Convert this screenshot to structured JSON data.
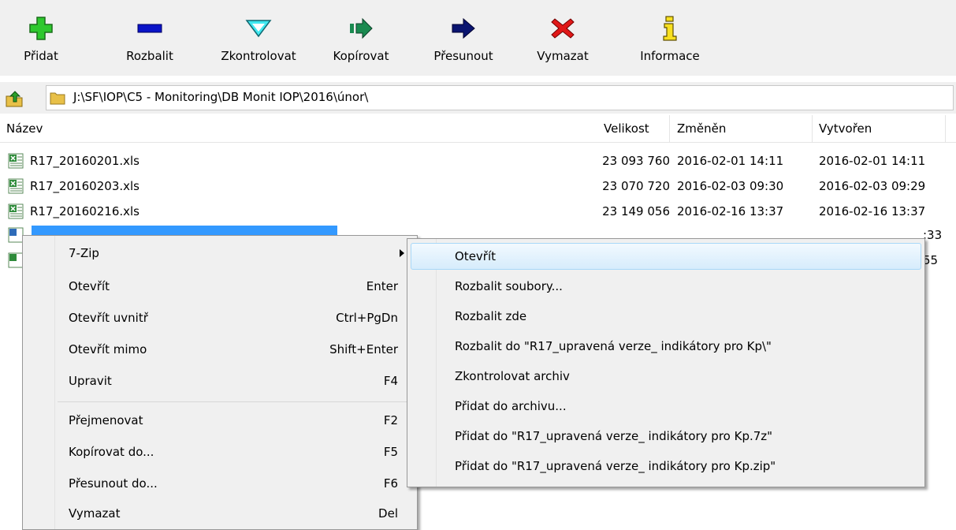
{
  "toolbar": {
    "buttons": [
      {
        "label": "Přidat",
        "icon": "plus-icon"
      },
      {
        "label": "Rozbalit",
        "icon": "minus-icon"
      },
      {
        "label": "Zkontrolovat",
        "icon": "check-icon"
      },
      {
        "label": "Kopírovat",
        "icon": "copy-arrow-icon"
      },
      {
        "label": "Přesunout",
        "icon": "move-arrow-icon"
      },
      {
        "label": "Vymazat",
        "icon": "delete-x-icon"
      },
      {
        "label": "Informace",
        "icon": "info-icon"
      }
    ]
  },
  "address": {
    "path": "J:\\SF\\IOP\\C5 - Monitoring\\DB Monit IOP\\2016\\únor\\"
  },
  "columns": {
    "name": "Název",
    "size": "Velikost",
    "modified": "Změněn",
    "created": "Vytvořen"
  },
  "files": [
    {
      "name": "R17_20160201.xls",
      "size": "23 093 760",
      "modified": "2016-02-01 14:11",
      "created": "2016-02-01 14:11"
    },
    {
      "name": "R17_20160203.xls",
      "size": "23 070 720",
      "modified": "2016-02-03 09:30",
      "created": "2016-02-03 09:29"
    },
    {
      "name": "R17_20160216.xls",
      "size": "23 149 056",
      "modified": "2016-02-16 13:37",
      "created": "2016-02-16 13:37"
    }
  ],
  "hidden_row_fragments": {
    "row4_created_tail": ":33",
    "row5_created_tail": "55"
  },
  "context_menu": {
    "items": [
      {
        "label": "7-Zip",
        "shortcut": "",
        "submenu": true
      },
      {
        "label": "Otevřít",
        "shortcut": "Enter"
      },
      {
        "label": "Otevřít uvnitř",
        "shortcut": "Ctrl+PgDn"
      },
      {
        "label": "Otevřít mimo",
        "shortcut": "Shift+Enter"
      },
      {
        "label": "Upravit",
        "shortcut": "F4"
      },
      {
        "label": "Přejmenovat",
        "shortcut": "F2"
      },
      {
        "label": "Kopírovat do...",
        "shortcut": "F5"
      },
      {
        "label": "Přesunout do...",
        "shortcut": "F6"
      },
      {
        "label": "Vymazat",
        "shortcut": "Del"
      }
    ]
  },
  "submenu": {
    "items": [
      "Otevřít",
      "Rozbalit soubory...",
      "Rozbalit zde",
      "Rozbalit do \"R17_upravená verze_ indikátory pro Kp\\\"",
      "Zkontrolovat archiv",
      "Přidat do archivu...",
      "Přidat do \"R17_upravená verze_ indikátory pro Kp.7z\"",
      "Přidat do \"R17_upravená verze_ indikátory pro Kp.zip\""
    ]
  },
  "colors": {
    "selection": "#3399ff",
    "menu_bg": "#f0f0f0",
    "highlight_border": "#a8d8f8"
  }
}
